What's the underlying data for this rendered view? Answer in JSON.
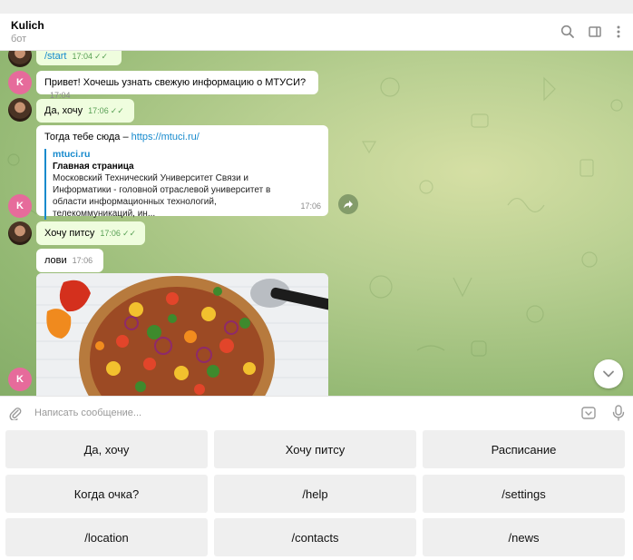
{
  "header": {
    "title": "Kulich",
    "subtitle": "бот",
    "icons": [
      "search-icon",
      "sidebar-toggle-icon",
      "more-vertical-icon"
    ]
  },
  "messages": [
    {
      "from": "user",
      "text": "/start",
      "time": "17:04",
      "read": true
    },
    {
      "from": "bot",
      "avatar_letter": "K",
      "text": "Привет! Хочешь узнать свежую информацию о МТУСИ?",
      "time": "17:04"
    },
    {
      "from": "user",
      "text": "Да, хочу",
      "time": "17:06",
      "read": true
    },
    {
      "from": "bot",
      "avatar_letter": "K",
      "text": "Тогда тебе сюда – ",
      "link": "https://mtuci.ru/",
      "time": "17:06",
      "preview": {
        "site": "mtuci.ru",
        "title": "Главная страница",
        "description": "Московский Технический Университет Связи и Информатики - головной отраслевой университет в области информационных технологий, телекоммуникаций, ин..."
      }
    },
    {
      "from": "user",
      "text": "Хочу питсу",
      "time": "17:06",
      "read": true
    },
    {
      "from": "bot",
      "text": "лови",
      "time": "17:06"
    },
    {
      "from": "bot",
      "avatar_letter": "K",
      "type": "photo",
      "photo": "pizza"
    }
  ],
  "composer": {
    "placeholder": "Написать сообщение...",
    "icons": [
      "attach-icon",
      "bot-keyboard-icon",
      "microphone-icon"
    ]
  },
  "keyboard": {
    "buttons": [
      "Да, хочу",
      "Хочу питсу",
      "Расписание",
      "Когда очка?",
      "/help",
      "/settings",
      "/location",
      "/contacts",
      "/news"
    ]
  },
  "colors": {
    "accent": "#168acd",
    "outgoing_bubble": "#effdde",
    "incoming_bubble": "#ffffff",
    "bot_avatar": "#e66b9b",
    "read_ticks": "#59a055",
    "keyboard_button": "#efefef"
  }
}
